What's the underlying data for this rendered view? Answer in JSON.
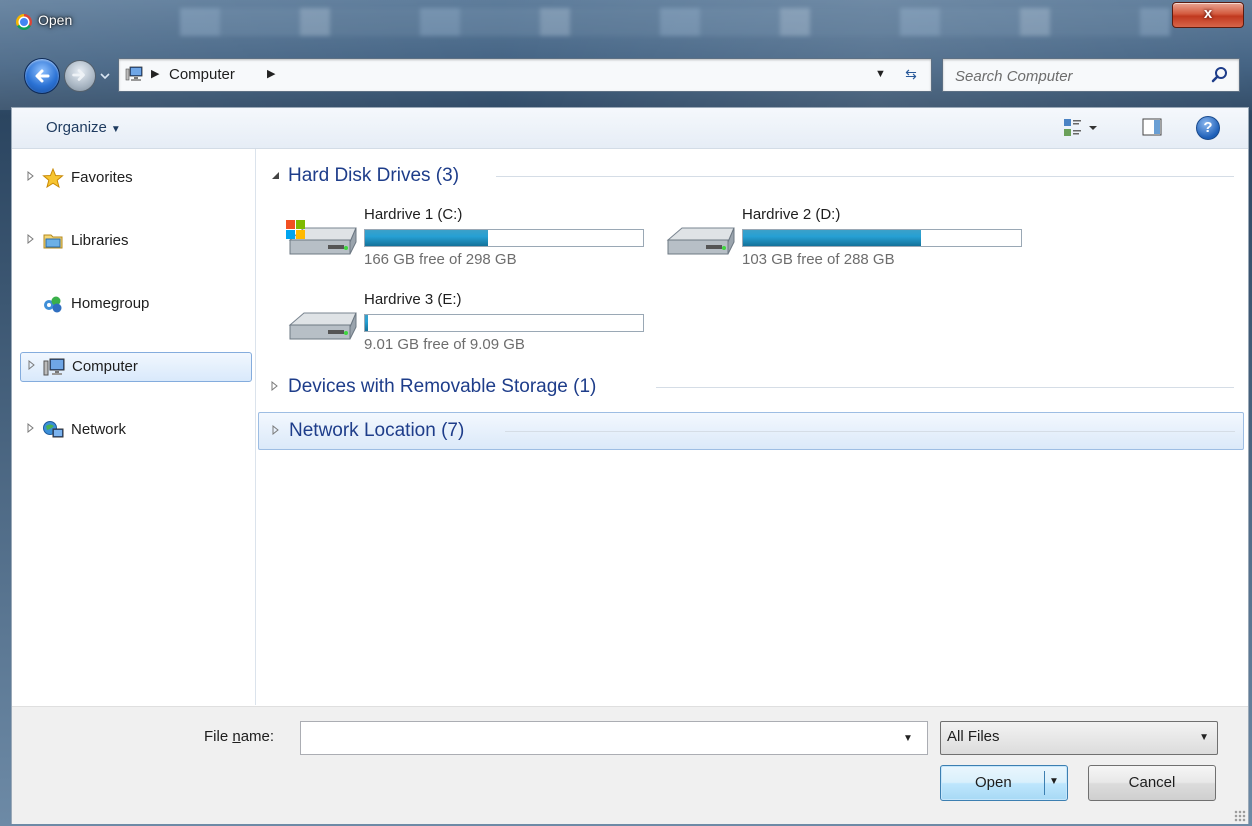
{
  "window": {
    "title": "Open",
    "close_label": "x"
  },
  "address_bar": {
    "breadcrumb": [
      "Computer"
    ]
  },
  "search": {
    "placeholder": "Search Computer"
  },
  "toolbar": {
    "organize_label": "Organize"
  },
  "nav_pane": {
    "items": [
      {
        "label": "Favorites",
        "icon": "star-icon",
        "expandable": true,
        "selected": false
      },
      {
        "label": "Libraries",
        "icon": "libraries-icon",
        "expandable": true,
        "selected": false
      },
      {
        "label": "Homegroup",
        "icon": "homegroup-icon",
        "expandable": false,
        "selected": false
      },
      {
        "label": "Computer",
        "icon": "computer-icon",
        "expandable": true,
        "selected": true
      },
      {
        "label": "Network",
        "icon": "network-icon",
        "expandable": true,
        "selected": false
      }
    ]
  },
  "content": {
    "groups": [
      {
        "title": "Hard Disk Drives (3)",
        "expanded": true
      },
      {
        "title": "Devices with Removable Storage (1)",
        "expanded": false
      },
      {
        "title": "Network Location (7)",
        "expanded": false,
        "selected": true
      }
    ],
    "drives": [
      {
        "name": "Hardrive 1 (C:)",
        "free_text": "166 GB free of 298 GB",
        "used_fraction": 0.443,
        "system": true
      },
      {
        "name": "Hardrive 2 (D:)",
        "free_text": "103 GB free of 288 GB",
        "used_fraction": 0.642,
        "system": false
      },
      {
        "name": "Hardrive 3 (E:)",
        "free_text": "9.01 GB free of 9.09 GB",
        "used_fraction": 0.009,
        "system": false
      }
    ]
  },
  "bottom": {
    "file_name_label_prefix": "File ",
    "file_name_label_underlined": "n",
    "file_name_label_suffix": "ame:",
    "file_name_value": "",
    "file_type_value": "All Files",
    "open_label": "Open",
    "cancel_label": "Cancel"
  },
  "colors": {
    "accent": "#1e3d8a",
    "drive_bar": "#26a0d4",
    "selection": "#d9e9fb"
  }
}
